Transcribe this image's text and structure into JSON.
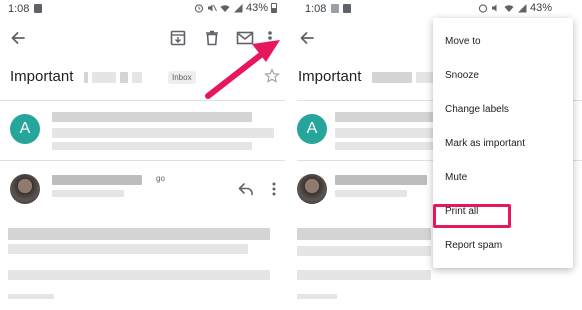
{
  "status_bar": {
    "time": "1:08",
    "battery": "43%"
  },
  "left": {
    "subject": "Important",
    "label_chip": "Inbox",
    "sender_initial": "A",
    "time_suffix": "go"
  },
  "right": {
    "subject": "Important",
    "sender_initial": "A"
  },
  "overflow_menu": {
    "items": [
      "Move to",
      "Snooze",
      "Change labels",
      "Mark as important",
      "Mute",
      "Print all",
      "Report spam"
    ],
    "highlighted": "Print all"
  },
  "colors": {
    "annotation_pink": "#e8175d",
    "avatar_teal": "#26a69a"
  },
  "icons": [
    "back-arrow-icon",
    "archive-icon",
    "delete-icon",
    "mail-icon",
    "more-vert-icon",
    "star-icon",
    "reply-icon"
  ]
}
